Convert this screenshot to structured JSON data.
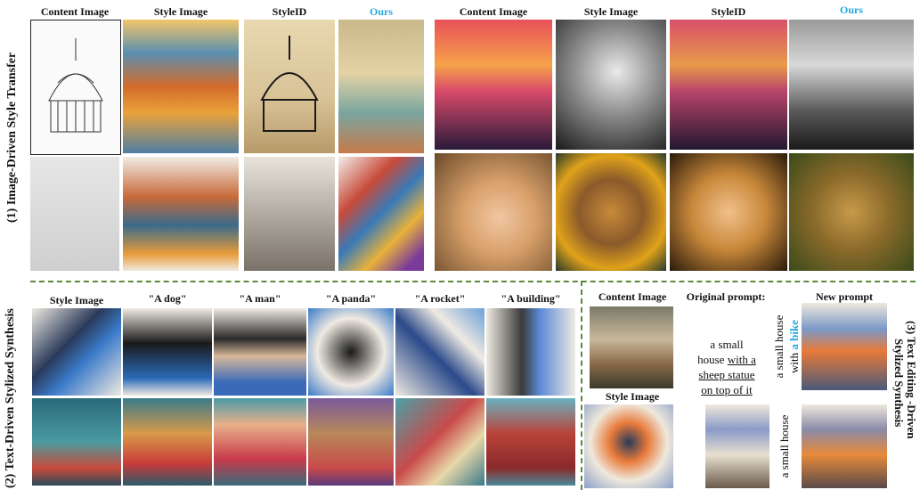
{
  "section1": {
    "label": "(1) Image-Driven Style Transfer",
    "left_headers": [
      "Content Image",
      "Style Image",
      "StyleID",
      "Ours"
    ],
    "right_headers": [
      "Content Image",
      "Style Image",
      "StyleID",
      "Ours"
    ]
  },
  "section2": {
    "label": "(2) Text-Driven Stylized Synthesis",
    "headers": [
      "Style Image",
      "\"A dog\"",
      "\"A man\"",
      "\"A panda\"",
      "\"A rocket\"",
      "\"A building\""
    ]
  },
  "section3": {
    "label_line1": "(3) Text Editing -Driven",
    "label_line2": "Stylized Synthesis",
    "content_header": "Content Image",
    "original_header": "Original prompt:",
    "new_header": "New prompt",
    "style_header": "Style Image",
    "original_prompt_l1": "a small",
    "original_prompt_l2": "house",
    "original_prompt_u1": "with a",
    "original_prompt_u2": "sheep statue",
    "original_prompt_u3": "on top of it",
    "new_prompt_1_a": "a small house",
    "new_prompt_1_b": "with",
    "new_prompt_1_c": "a bike",
    "new_prompt_2": "a small house"
  },
  "colors": {
    "accent": "#28a8e0",
    "dash": "#5a8a3a"
  }
}
